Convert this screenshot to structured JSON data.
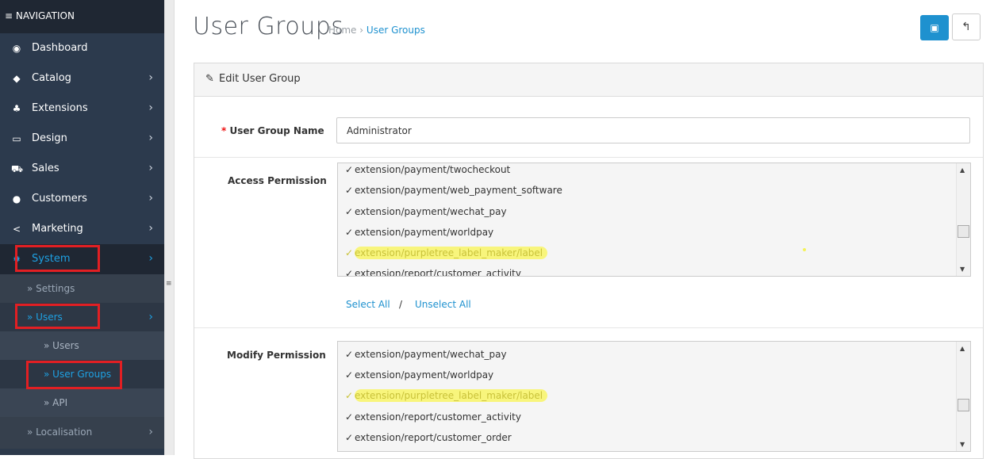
{
  "sidebar": {
    "header": "NAVIGATION",
    "items": [
      {
        "label": "Dashboard",
        "icon": "dashboard-icon",
        "arrow": ""
      },
      {
        "label": "Catalog",
        "icon": "tag-icon",
        "arrow": "›"
      },
      {
        "label": "Extensions",
        "icon": "puzzle-icon",
        "arrow": "›"
      },
      {
        "label": "Design",
        "icon": "monitor-icon",
        "arrow": "›"
      },
      {
        "label": "Sales",
        "icon": "cart-icon",
        "arrow": "›"
      },
      {
        "label": "Customers",
        "icon": "user-icon",
        "arrow": "›"
      },
      {
        "label": "Marketing",
        "icon": "share-icon",
        "arrow": "›"
      },
      {
        "label": "System",
        "icon": "gear-icon",
        "arrow": "›"
      }
    ],
    "system_sub": {
      "settings": "» Settings",
      "users": "» Users",
      "users_arrow": "›",
      "users_sub": [
        "» Users",
        "» User Groups",
        "» API"
      ],
      "localisation": "» Localisation",
      "localisation_arrow": "›"
    }
  },
  "header": {
    "title": "User Groups",
    "breadcrumb_home": "Home",
    "breadcrumb_sep": "›",
    "breadcrumb_current": "User Groups"
  },
  "panel": {
    "title": "Edit User Group",
    "name_label": "User Group Name",
    "name_required": "*",
    "name_value": "Administrator",
    "access_label": "Access Permission",
    "access_items": [
      "extension/payment/twocheckout",
      "extension/payment/web_payment_software",
      "extension/payment/wechat_pay",
      "extension/payment/worldpay",
      "extension/purpletree_label_maker/label",
      "extension/report/customer_activity"
    ],
    "select_all": "Select All",
    "select_sep": "/",
    "unselect_all": "Unselect All",
    "modify_label": "Modify Permission",
    "modify_items": [
      "extension/payment/wechat_pay",
      "extension/payment/worldpay",
      "extension/purpletree_label_maker/label",
      "extension/report/customer_activity",
      "extension/report/customer_order"
    ]
  },
  "colors": {
    "sidebar_bg": "#2d3a4b",
    "accent": "#1e91cf",
    "highlight": "#f8f57c",
    "annotation": "#e21f23"
  }
}
